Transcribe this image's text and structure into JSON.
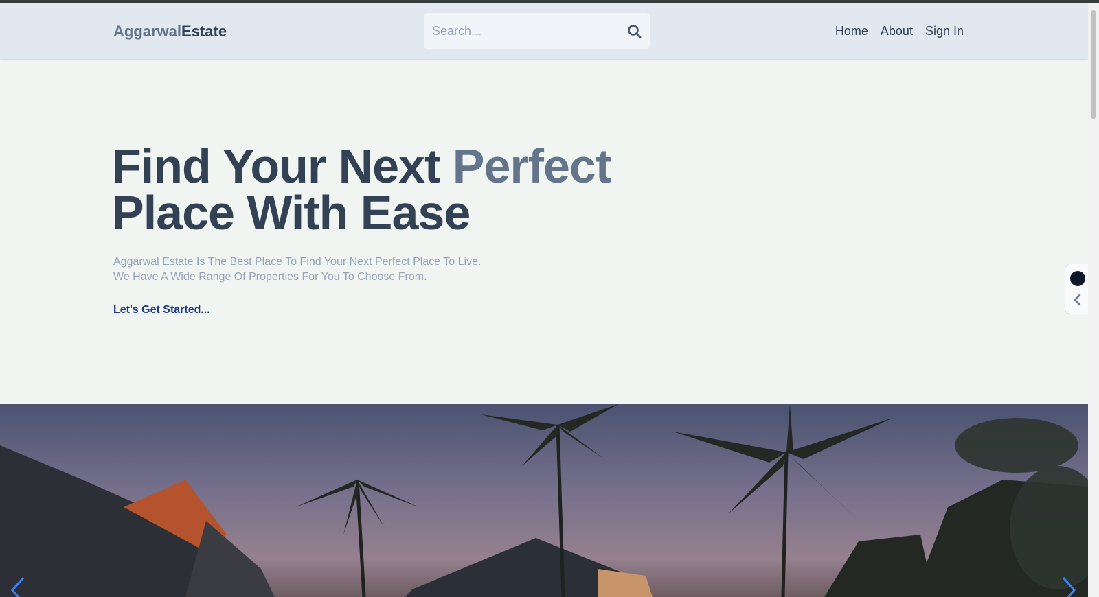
{
  "header": {
    "logo_part1": "Aggarwal",
    "logo_part2": "Estate",
    "search_placeholder": "Search...",
    "nav": [
      "Home",
      "About",
      "Sign In"
    ]
  },
  "hero": {
    "title_line1_main": "Find Your Next ",
    "title_line1_accent": "Perfect",
    "title_line2": "Place With Ease",
    "desc_line1": "Aggarwal Estate Is The Best Place To Find Your Next Perfect Place To Live.",
    "desc_line2": "We Have A Wide Range Of Properties For You To Choose From.",
    "cta": "Let's Get Started..."
  },
  "icons": {
    "search": "search-icon",
    "side_dot": "extension-icon",
    "side_chevron": "chevron-left-icon",
    "carousel_prev": "chevron-left-icon",
    "carousel_next": "chevron-right-icon"
  },
  "colors": {
    "header_bg": "#e2e8f0",
    "page_bg": "#f1f5f1",
    "text_dark": "#334155",
    "text_accent": "#64748b",
    "cta": "#1e3a8a",
    "carousel_arrow": "#3b82f6"
  }
}
